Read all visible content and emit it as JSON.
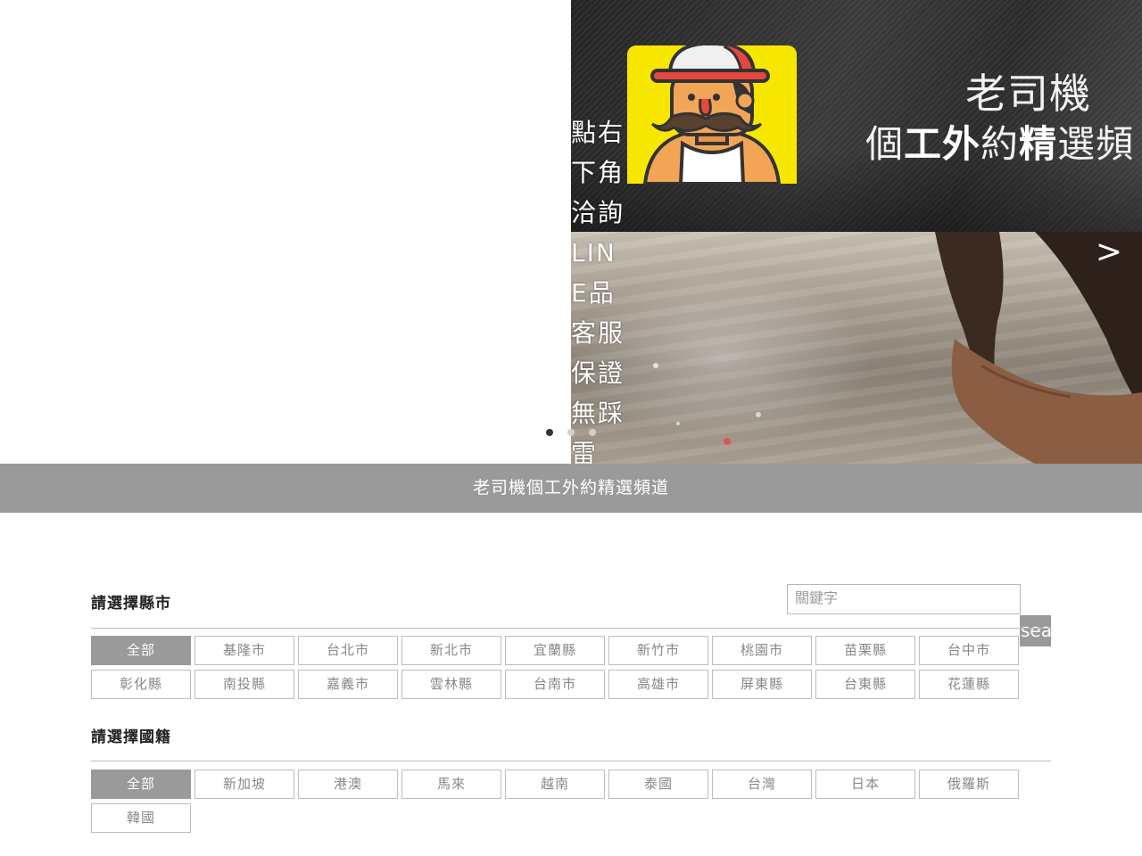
{
  "hero": {
    "side_text": "點右下角洽詢LINE品客服保證無踩雷",
    "next_arrow": ">",
    "banner": {
      "line1": "老司機",
      "line2": [
        "個",
        "工外",
        "約",
        "精",
        "選頻"
      ]
    },
    "slide_count": 3,
    "active_slide": 0
  },
  "title_bar": "老司機個工外約精選頻道",
  "search": {
    "placeholder": "關鍵字",
    "button_label": "search"
  },
  "city": {
    "label": "請選擇縣市",
    "options": [
      "全部",
      "基隆市",
      "台北市",
      "新北市",
      "宜蘭縣",
      "新竹市",
      "桃園市",
      "苗栗縣",
      "台中市",
      "彰化縣",
      "南投縣",
      "嘉義市",
      "雲林縣",
      "台南市",
      "高雄市",
      "屏東縣",
      "台東縣",
      "花蓮縣"
    ],
    "selected": "全部"
  },
  "nationality": {
    "label": "請選擇國籍",
    "options": [
      "全部",
      "新加坡",
      "港澳",
      "馬來",
      "越南",
      "泰國",
      "台灣",
      "日本",
      "俄羅斯",
      "韓國"
    ],
    "selected": "全部"
  },
  "colors": {
    "title_bar": "#9a9a9a",
    "active_button": "#9a9a9a",
    "logo_bg": "#f7e600",
    "banner_bg": "#2e2e2e"
  }
}
